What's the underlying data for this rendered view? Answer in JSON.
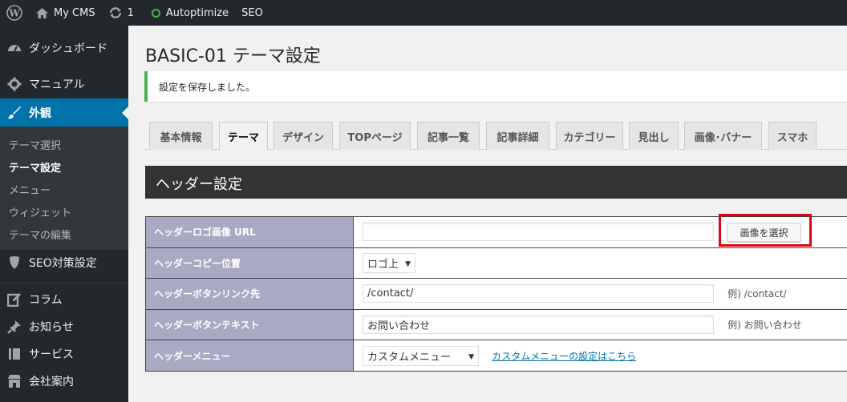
{
  "adminbar": {
    "site_name": "My CMS",
    "updates_count": "1",
    "autoptimize": "Autoptimize",
    "seo": "SEO"
  },
  "sidebar": {
    "dashboard": "ダッシュボード",
    "manual": "マニュアル",
    "appearance": "外観",
    "submenu": [
      "テーマ選択",
      "テーマ設定",
      "メニュー",
      "ウィジェット",
      "テーマの編集"
    ],
    "seo_settings": "SEO対策設定",
    "column": "コラム",
    "news": "お知らせ",
    "service": "サービス",
    "company": "会社案内"
  },
  "page": {
    "title": "BASIC-01 テーマ設定",
    "notice": "設定を保存しました。",
    "tabs": [
      "基本情報",
      "テーマ",
      "デザイン",
      "TOPページ",
      "記事一覧",
      "記事詳細",
      "カテゴリー",
      "見出し",
      "画像･バナー",
      "スマホ"
    ],
    "active_tab": "テーマ",
    "section_header": "ヘッダー設定"
  },
  "settings": {
    "logo_url_label": "ヘッダーロゴ画像 URL",
    "logo_url_value": "",
    "select_image_button": "画像を選択",
    "copy_position_label": "ヘッダーコピー位置",
    "copy_position_value": "ロゴ上",
    "button_link_label": "ヘッダーボタンリンク先",
    "button_link_value": "/contact/",
    "button_link_example": "例) /contact/",
    "button_text_label": "ヘッダーボタンテキスト",
    "button_text_value": "お問い合わせ",
    "button_text_example": "例) お問い合わせ",
    "menu_label": "ヘッダーメニュー",
    "menu_value": "カスタムメニュー",
    "menu_link": "カスタムメニューの設定はこちら"
  },
  "colors": {
    "admin_dark": "#23282d",
    "accent_blue": "#0073aa",
    "notice_green": "#46b450",
    "label_cell": "#a9a9c4",
    "highlight_red": "#e30010"
  }
}
